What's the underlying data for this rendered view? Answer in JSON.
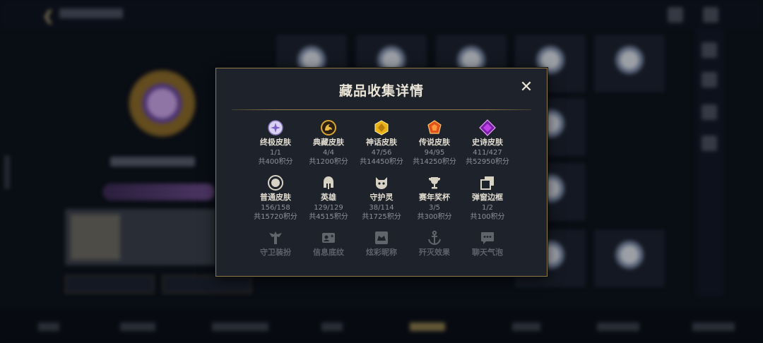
{
  "dialog": {
    "title": "藏品收集详情",
    "close_label": "✕"
  },
  "rows": [
    [
      {
        "icon": "ultimate-skin-icon",
        "name": "终极皮肤",
        "count": "1/1",
        "points": "共400积分"
      },
      {
        "icon": "prestige-skin-icon",
        "name": "典藏皮肤",
        "count": "4/4",
        "points": "共1200积分"
      },
      {
        "icon": "mythic-skin-icon",
        "name": "神话皮肤",
        "count": "47/56",
        "points": "共14450积分"
      },
      {
        "icon": "legendary-skin-icon",
        "name": "传说皮肤",
        "count": "94/95",
        "points": "共14250积分"
      },
      {
        "icon": "epic-skin-icon",
        "name": "史诗皮肤",
        "count": "411/427",
        "points": "共52950积分"
      }
    ],
    [
      {
        "icon": "normal-skin-icon",
        "name": "普通皮肤",
        "count": "156/158",
        "points": "共15720积分"
      },
      {
        "icon": "hero-helmet-icon",
        "name": "英雄",
        "count": "129/129",
        "points": "共4515积分"
      },
      {
        "icon": "guardian-spirit-icon",
        "name": "守护灵",
        "count": "38/114",
        "points": "共1725积分"
      },
      {
        "icon": "season-trophy-icon",
        "name": "赛年奖杯",
        "count": "3/5",
        "points": "共300积分"
      },
      {
        "icon": "popup-frame-icon",
        "name": "弹窗边框",
        "count": "1/2",
        "points": "共100积分"
      }
    ],
    [
      {
        "icon": "guardian-outfit-icon",
        "name": "守卫装扮"
      },
      {
        "icon": "profile-banner-icon",
        "name": "信息底纹"
      },
      {
        "icon": "glow-nickname-icon",
        "name": "炫彩昵称"
      },
      {
        "icon": "kill-effect-icon",
        "name": "歼灭效果"
      },
      {
        "icon": "chat-bubble-icon",
        "name": "聊天气泡"
      }
    ]
  ],
  "colors": {
    "accent_gold": "#8f7a45",
    "dialog_bg": "#1e222b",
    "title_text": "#e9e4d6",
    "muted_text": "#8d919a"
  }
}
